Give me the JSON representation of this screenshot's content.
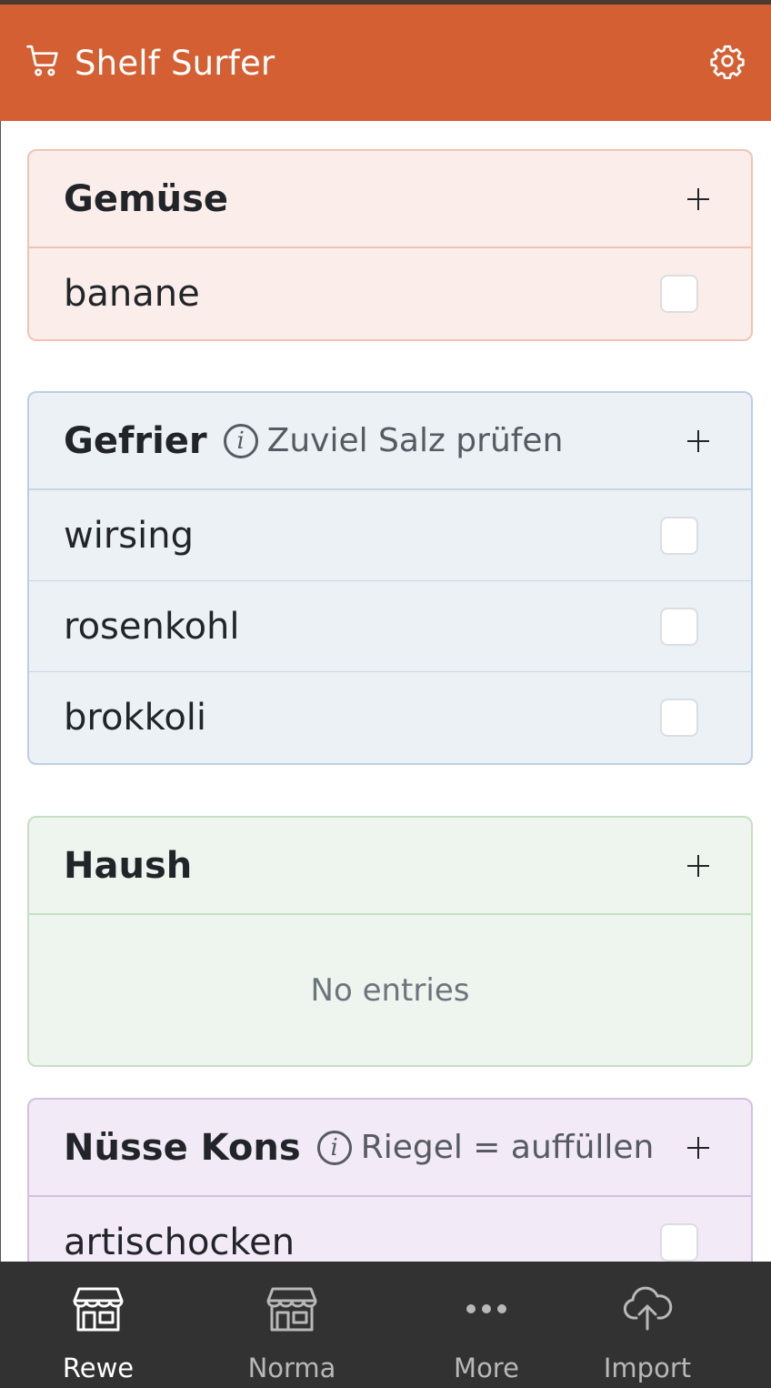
{
  "app": {
    "title": "Shelf Surfer",
    "accent_color": "#d45f33",
    "brand_icon": "cart-icon",
    "settings_icon": "gear-icon"
  },
  "categories": [
    {
      "name": "Gemüse",
      "color": "#fbeeea",
      "note": "",
      "items": [
        "banane"
      ]
    },
    {
      "name": "Gefrier",
      "color": "#ecf1f6",
      "note": "Zuviel Salz prüfen",
      "items": [
        "wirsing",
        "rosenkohl",
        "brokkoli"
      ]
    },
    {
      "name": "Haush",
      "color": "#eef5ee",
      "note": "",
      "items": [],
      "empty_text": "No entries"
    },
    {
      "name": "Nüsse Kons",
      "color": "#f2eaf6",
      "note": "Riegel = auffüllen",
      "items": [
        "artischocken"
      ]
    }
  ],
  "bottom_nav": {
    "active": "Rewe",
    "items": [
      {
        "label": "Rewe",
        "icon": "store-icon"
      },
      {
        "label": "Norma",
        "icon": "store-icon"
      },
      {
        "label": "More",
        "icon": "more-dots-icon"
      },
      {
        "label": "Import",
        "icon": "cloud-upload-icon"
      }
    ]
  }
}
